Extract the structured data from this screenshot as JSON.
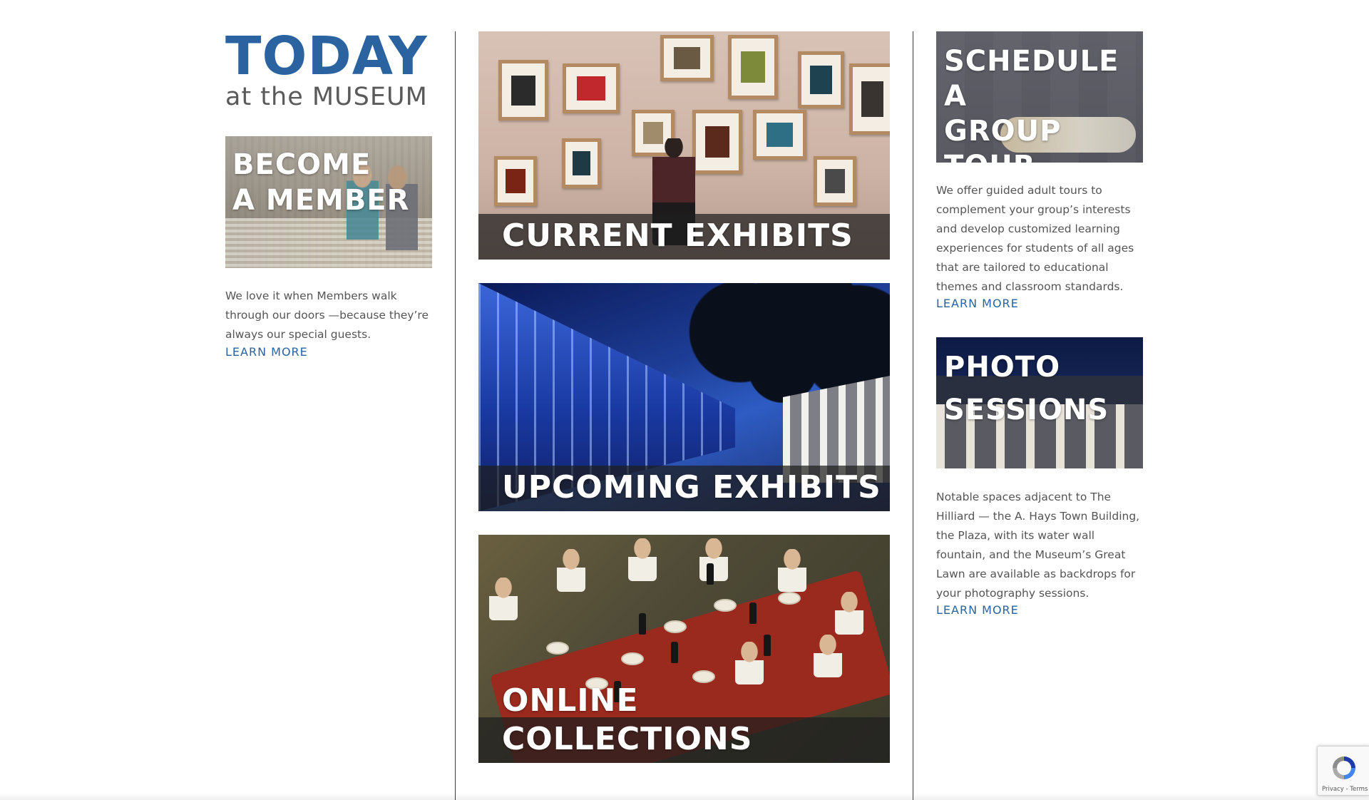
{
  "header": {
    "title_main": "TODAY",
    "title_sub": "at the MUSEUM"
  },
  "member": {
    "tile_line1": "BECOME",
    "tile_line2": "A MEMBER",
    "description": "We love it when Members walk through our doors —because they’re always our special guests.",
    "link": "LEARN MORE"
  },
  "center_tiles": [
    {
      "label": "CURRENT EXHIBITS"
    },
    {
      "label": "UPCOMING EXHIBITS"
    },
    {
      "label": "ONLINE COLLECTIONS"
    }
  ],
  "group_tour": {
    "tile_line1": "SCHEDULE A",
    "tile_line2": "GROUP",
    "tile_line3": "TOUR",
    "description": "We offer guided adult tours to complement your group’s interests and develop customized learning experiences for students of all ages that are tailored to educational themes and classroom standards.",
    "link": "LEARN MORE"
  },
  "photo": {
    "tile_line1": "PHOTO",
    "tile_line2": "SESSIONS",
    "description": "Notable spaces adjacent to The Hilliard — the A. Hays Town Building, the Plaza, with its water wall fountain, and the Museum’s Great Lawn are available as backdrops for your photography sessions.",
    "link": "LEARN MORE"
  },
  "recaptcha": {
    "links": "Privacy - Terms"
  },
  "colors": {
    "brand_blue": "#2a63a0",
    "body_text": "#555555",
    "heading_gray": "#5a5a5a"
  }
}
